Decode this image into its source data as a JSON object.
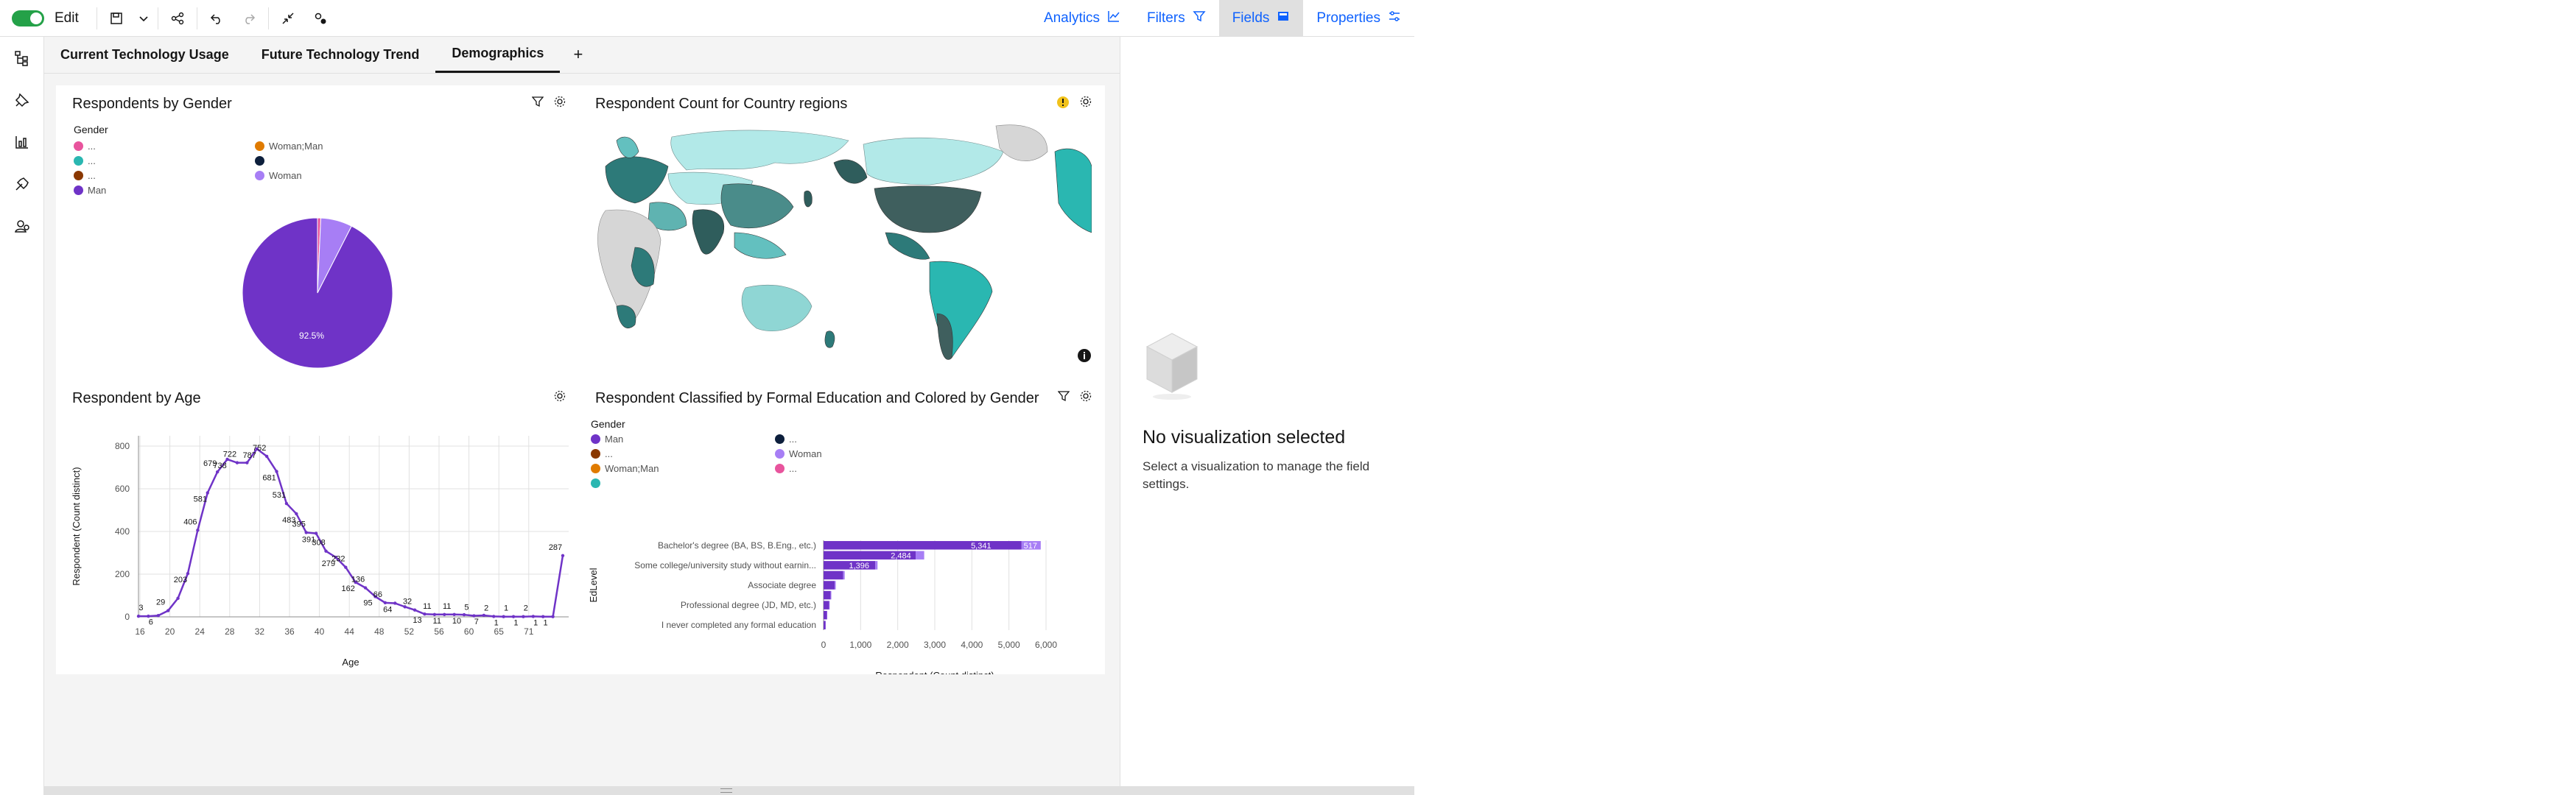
{
  "toolbar": {
    "edit_label": "Edit",
    "tabs": [
      {
        "label": "Analytics"
      },
      {
        "label": "Filters"
      },
      {
        "label": "Fields"
      },
      {
        "label": "Properties"
      }
    ]
  },
  "dashboard_tabs": [
    "Current Technology Usage",
    "Future Technology Trend",
    "Demographics"
  ],
  "add_tab_label": "+",
  "cards": {
    "gender": {
      "title": "Respondents by Gender",
      "legend_title": "Gender",
      "legend_left": [
        {
          "label": "...",
          "color": "#e8549d"
        },
        {
          "label": "...",
          "color": "#2ab7b1"
        },
        {
          "label": "...",
          "color": "#8a3800"
        },
        {
          "label": "Man",
          "color": "#6f33c7"
        }
      ],
      "legend_right": [
        {
          "label": "Woman;Man",
          "color": "#e07b00"
        },
        {
          "label": "",
          "color": "#0d1f3c"
        },
        {
          "label": "Woman",
          "color": "#a77ef5"
        }
      ],
      "pie_label": "92.5%"
    },
    "map": {
      "title": "Respondent Count for Country regions"
    },
    "age": {
      "title": "Respondent by Age",
      "xlabel": "Age",
      "ylabel": "Respondent (Count distinct)"
    },
    "education": {
      "title": "Respondent Classified by Formal Education and Colored by Gender",
      "legend_title": "Gender",
      "legend_left": [
        {
          "label": "Man",
          "color": "#6f33c7"
        },
        {
          "label": "...",
          "color": "#8a3800"
        },
        {
          "label": "Woman;Man",
          "color": "#e07b00"
        },
        {
          "label": "",
          "color": "#2ab7b1"
        }
      ],
      "legend_right": [
        {
          "label": "...",
          "color": "#0d1f3c"
        },
        {
          "label": "Woman",
          "color": "#a77ef5"
        },
        {
          "label": "...",
          "color": "#e8549d"
        }
      ],
      "ylabel": "EdLevel",
      "xlabel": "Respondent (Count distinct)"
    }
  },
  "panel": {
    "title": "No visualization selected",
    "description": "Select a visualization to manage the field settings."
  },
  "chart_data": [
    {
      "type": "pie",
      "title": "Respondents by Gender",
      "slices": [
        {
          "label": "Man",
          "value": 92.5,
          "color": "#6f33c7"
        },
        {
          "label": "Woman",
          "value": 6.8,
          "color": "#a77ef5"
        },
        {
          "label": "...",
          "value": 0.7,
          "color": "#e8549d"
        }
      ],
      "data_labels": [
        "92.5%"
      ]
    },
    {
      "type": "line",
      "title": "Respondent by Age",
      "xlabel": "Age",
      "ylabel": "Respondent (Count distinct)",
      "ylim": [
        0,
        800
      ],
      "y_ticks": [
        0,
        200,
        400,
        600,
        800
      ],
      "x_tick_labels": [
        "16",
        "20",
        "24",
        "28",
        "32",
        "36",
        "40",
        "44",
        "48",
        "52",
        "56",
        "60",
        "65",
        "71"
      ],
      "points": [
        [
          15,
          3
        ],
        [
          16,
          3
        ],
        [
          17,
          6
        ],
        [
          18,
          29
        ],
        [
          19,
          87
        ],
        [
          20,
          203
        ],
        [
          21,
          406
        ],
        [
          22,
          581
        ],
        [
          23,
          679
        ],
        [
          24,
          738
        ],
        [
          25,
          722
        ],
        [
          26,
          722
        ],
        [
          27,
          787
        ],
        [
          28,
          752
        ],
        [
          29,
          681
        ],
        [
          30,
          531
        ],
        [
          31,
          483
        ],
        [
          32,
          395
        ],
        [
          33,
          391
        ],
        [
          34,
          308
        ],
        [
          35,
          279
        ],
        [
          36,
          232
        ],
        [
          37,
          162
        ],
        [
          38,
          136
        ],
        [
          39,
          95
        ],
        [
          40,
          66
        ],
        [
          41,
          64
        ],
        [
          42,
          47
        ],
        [
          43,
          32
        ],
        [
          44,
          13
        ],
        [
          45,
          11
        ],
        [
          46,
          11
        ],
        [
          47,
          11
        ],
        [
          48,
          10
        ],
        [
          49,
          5
        ],
        [
          50,
          7
        ],
        [
          51,
          2
        ],
        [
          52,
          1
        ],
        [
          53,
          1
        ],
        [
          54,
          1
        ],
        [
          55,
          2
        ],
        [
          56,
          1
        ],
        [
          57,
          1
        ],
        [
          58,
          287
        ]
      ],
      "data_labels": [
        "3",
        "6",
        "29",
        "203",
        "406",
        "581",
        "679",
        "738",
        "722",
        "787",
        "752",
        "681",
        "531",
        "483",
        "395",
        "391",
        "308",
        "279",
        "232",
        "162",
        "136",
        "95",
        "66",
        "64",
        "32",
        "13",
        "11",
        "11",
        "11",
        "10",
        "5",
        "7",
        "2",
        "1",
        "1",
        "1",
        "2",
        "1",
        "287",
        "1"
      ]
    },
    {
      "type": "bar",
      "orientation": "horizontal",
      "stacked": true,
      "title": "Respondent Classified by Formal Education and Colored by Gender",
      "xlabel": "Respondent (Count distinct)",
      "ylabel": "EdLevel",
      "xlim": [
        0,
        6000
      ],
      "x_ticks": [
        "0",
        "1,000",
        "2,000",
        "3,000",
        "4,000",
        "5,000",
        "6,000"
      ],
      "categories": [
        "Bachelor's degree (BA, BS, B.Eng., etc.)",
        "",
        "Some college/university study without earnin...",
        "",
        "Associate degree",
        "",
        "Professional degree (JD, MD, etc.)",
        "",
        "I never completed any formal education"
      ],
      "series": [
        {
          "name": "Man",
          "color": "#6f33c7",
          "values": [
            5341,
            2484,
            1396,
            530,
            300,
            190,
            150,
            90,
            50
          ]
        },
        {
          "name": "Woman",
          "color": "#a77ef5",
          "values": [
            517,
            230,
            60,
            40,
            30,
            20,
            15,
            10,
            5
          ]
        }
      ],
      "data_labels": [
        "5,341",
        "517",
        "2,484",
        "1,396"
      ]
    }
  ]
}
